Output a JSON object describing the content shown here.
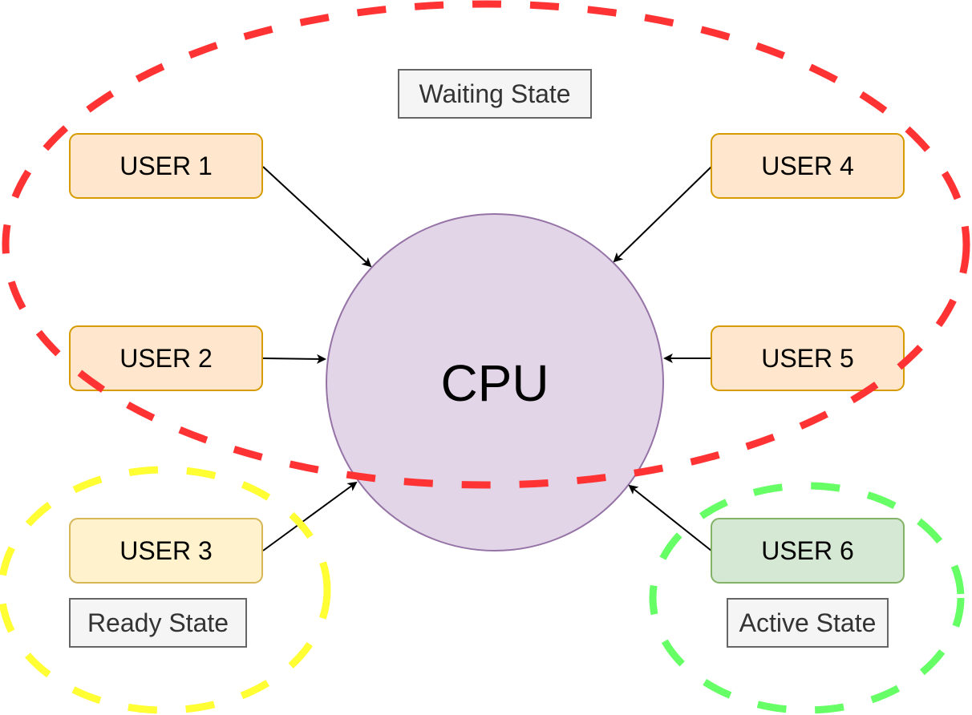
{
  "diagram": {
    "cpu": {
      "label": "CPU",
      "fill": "#e1d5e7",
      "stroke": "#9673a6"
    },
    "users": [
      {
        "id": "user1",
        "label": "USER 1",
        "fill": "#ffe6cc",
        "stroke": "#d79b00",
        "state": "waiting"
      },
      {
        "id": "user2",
        "label": "USER 2",
        "fill": "#ffe6cc",
        "stroke": "#d79b00",
        "state": "waiting"
      },
      {
        "id": "user3",
        "label": "USER 3",
        "fill": "#fff2cc",
        "stroke": "#d6b656",
        "state": "ready"
      },
      {
        "id": "user4",
        "label": "USER 4",
        "fill": "#ffe6cc",
        "stroke": "#d79b00",
        "state": "waiting"
      },
      {
        "id": "user5",
        "label": "USER 5",
        "fill": "#ffe6cc",
        "stroke": "#d79b00",
        "state": "waiting"
      },
      {
        "id": "user6",
        "label": "USER 6",
        "fill": "#d5e8d4",
        "stroke": "#82b366",
        "state": "active"
      }
    ],
    "state_labels": {
      "waiting": "Waiting State",
      "ready": "Ready State",
      "active": "Active State"
    },
    "state_colors": {
      "waiting": "#ff3333",
      "ready": "#ffff33",
      "active": "#66ff66"
    },
    "label_box": {
      "fill": "#f5f5f5",
      "stroke": "#666666"
    },
    "edges": [
      {
        "from": "user1",
        "to": "cpu"
      },
      {
        "from": "user2",
        "to": "cpu"
      },
      {
        "from": "user3",
        "to": "cpu"
      },
      {
        "from": "user4",
        "to": "cpu"
      },
      {
        "from": "user5",
        "to": "cpu"
      },
      {
        "from": "user6",
        "to": "cpu"
      }
    ]
  }
}
